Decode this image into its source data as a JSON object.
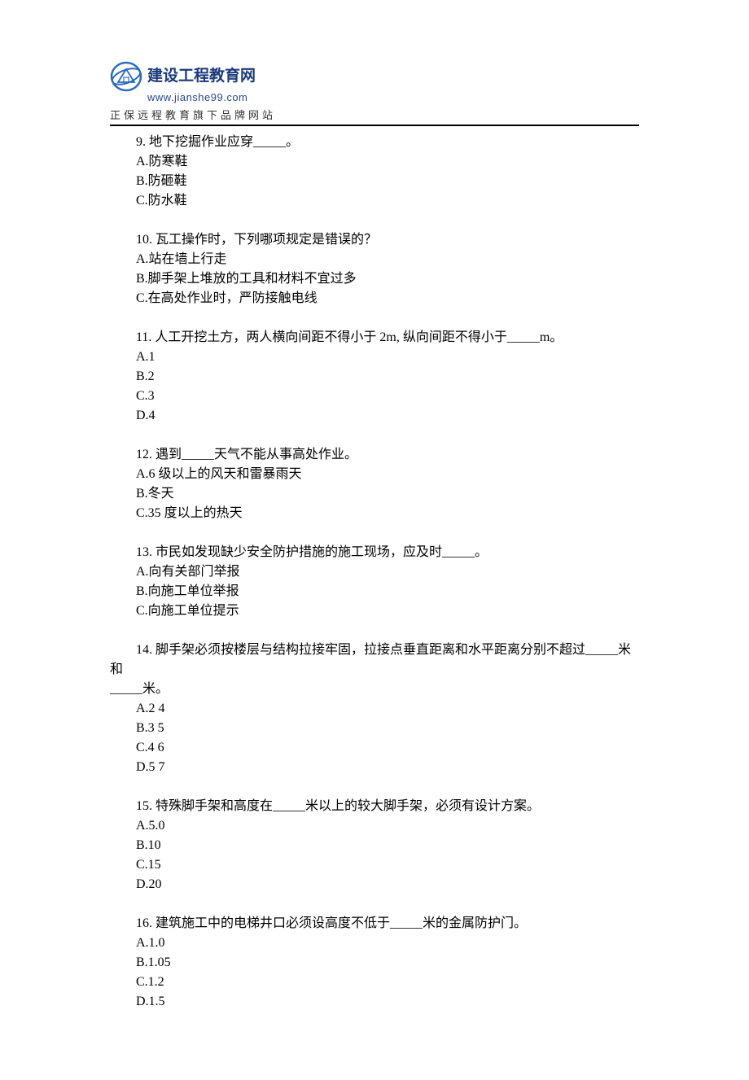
{
  "header": {
    "brand": "建设工程教育网",
    "url": "www.jianshe99.com",
    "tagline": "正保远程教育旗下品牌网站"
  },
  "questions": [
    {
      "num": "9.",
      "text": "地下挖掘作业应穿_____。",
      "opts": [
        "A.防寒鞋",
        "B.防砸鞋",
        "C.防水鞋"
      ]
    },
    {
      "num": "10.",
      "text": "瓦工操作时，下列哪项规定是错误的？",
      "opts": [
        "A.站在墙上行走",
        "B.脚手架上堆放的工具和材料不宜过多",
        "C.在高处作业时，严防接触电线"
      ]
    },
    {
      "num": "11.",
      "text": "人工开挖土方，两人横向间距不得小于 2m, 纵向间距不得小于_____m。",
      "opts": [
        "A.1",
        "B.2",
        "C.3",
        "D.4"
      ]
    },
    {
      "num": "12.",
      "text": "遇到_____天气不能从事高处作业。",
      "opts": [
        "A.6 级以上的风天和雷暴雨天",
        "B.冬天",
        "C.35 度以上的热天"
      ]
    },
    {
      "num": "13.",
      "text": "市民如发现缺少安全防护措施的施工现场，应及时_____。",
      "opts": [
        "A.向有关部门举报",
        "B.向施工单位举报",
        "C.向施工单位提示"
      ]
    },
    {
      "num": "14.",
      "text": "脚手架必须按楼层与结构拉接牢固，拉接点垂直距离和水平距离分别不超过_____米和",
      "cont": "_____米。",
      "opts": [
        "A.2 4",
        "B.3 5",
        "C.4 6",
        "D.5 7"
      ]
    },
    {
      "num": "15.",
      "text": "特殊脚手架和高度在_____米以上的较大脚手架，必须有设计方案。",
      "opts": [
        "A.5.0",
        "B.10",
        "C.15",
        "D.20"
      ]
    },
    {
      "num": "16.",
      "text": "建筑施工中的电梯井口必须设高度不低于_____米的金属防护门。",
      "opts": [
        "A.1.0",
        "B.1.05",
        "C.1.2",
        "D.1.5"
      ]
    }
  ]
}
